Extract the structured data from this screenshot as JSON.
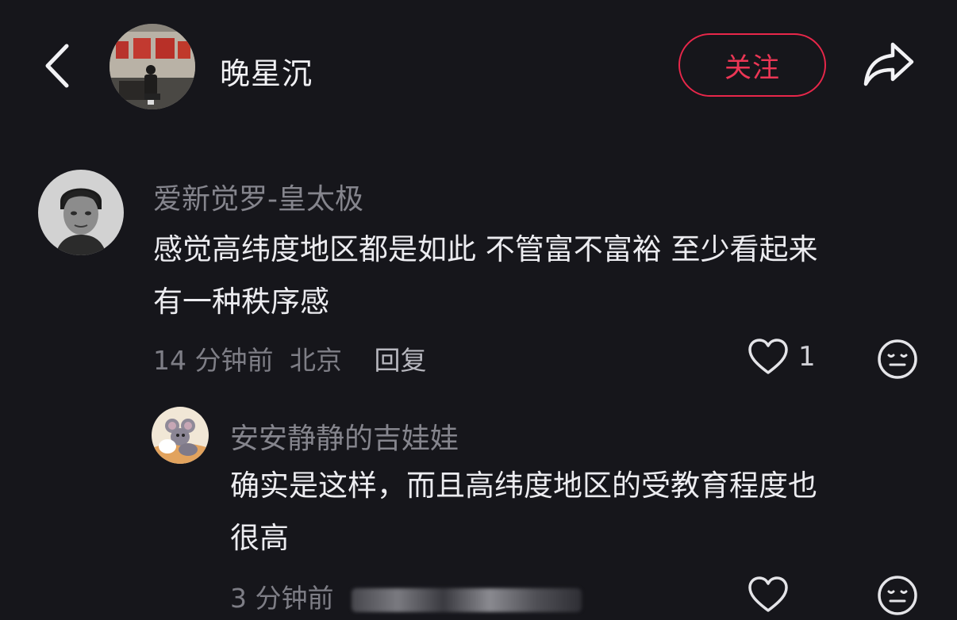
{
  "header": {
    "username": "晚星沉",
    "follow_label": "关注",
    "icons": {
      "back": "back-chevron-icon",
      "share": "share-arrow-icon"
    }
  },
  "comments": [
    {
      "username": "爱新觉罗-皇太极",
      "text_lines": [
        "感觉高纬度地区都是如此 不管富不富裕 至少看起来",
        "有一种秩序感"
      ],
      "time": "14 分钟前",
      "location": "北京",
      "reply_label": "回复",
      "likes": "1"
    }
  ],
  "replies": [
    {
      "username": "安安静静的吉娃娃",
      "text_lines": [
        "确实是这样，而且高纬度地区的受教育程度也",
        "很高"
      ],
      "time": "3 分钟前"
    }
  ],
  "colors": {
    "background": "#16161b",
    "accent": "#e8274a"
  }
}
